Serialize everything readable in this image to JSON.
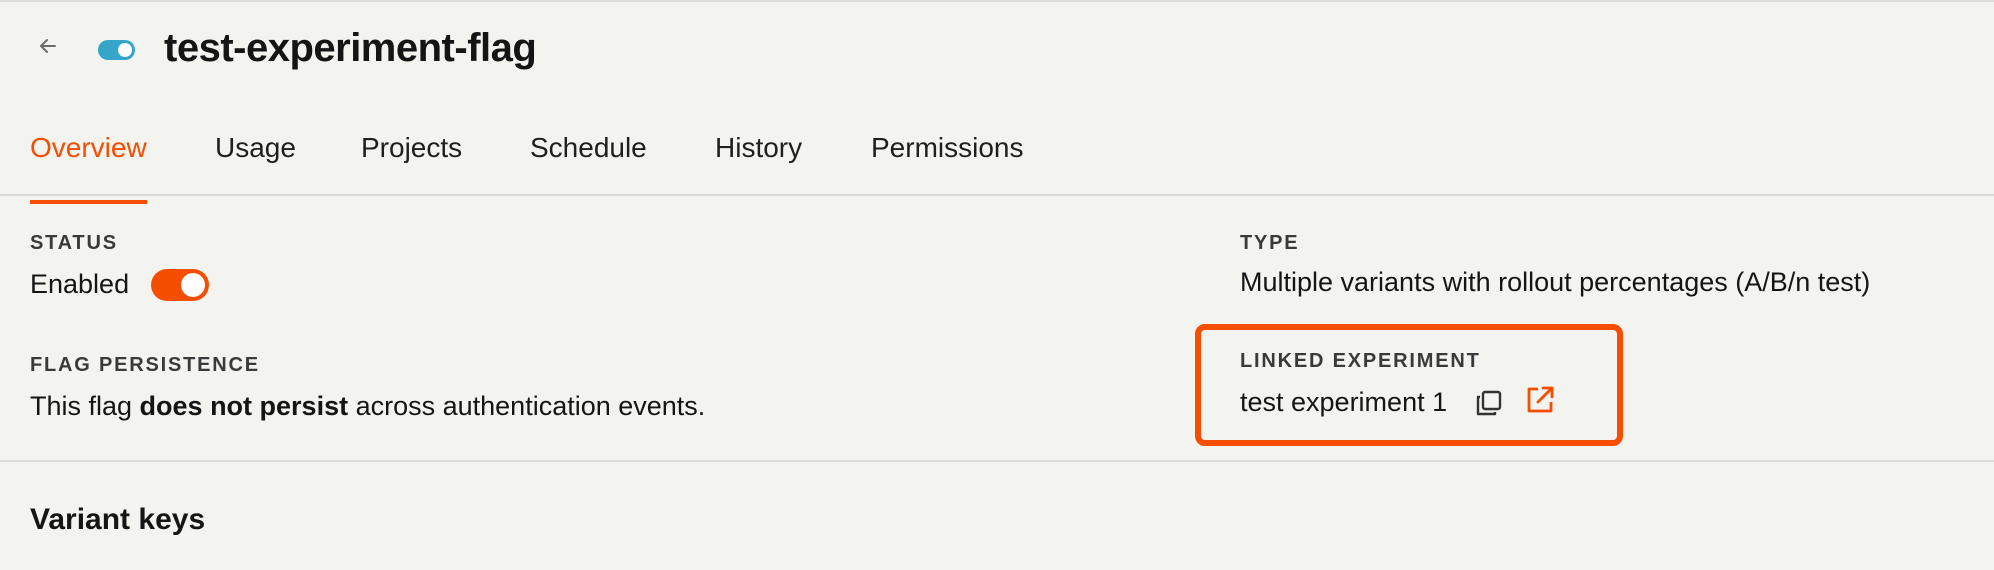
{
  "colors": {
    "accent": "#f54e00",
    "accent_teal": "#35a6c8"
  },
  "header": {
    "back_icon": "arrow-left-icon",
    "flag_icon": "toggle-icon",
    "title": "test-experiment-flag"
  },
  "tabs": [
    {
      "label": "Overview",
      "active": true
    },
    {
      "label": "Usage",
      "active": false
    },
    {
      "label": "Projects",
      "active": false
    },
    {
      "label": "Schedule",
      "active": false
    },
    {
      "label": "History",
      "active": false
    },
    {
      "label": "Permissions",
      "active": false
    }
  ],
  "status": {
    "label": "STATUS",
    "value": "Enabled",
    "enabled": true
  },
  "type": {
    "label": "TYPE",
    "value": "Multiple variants with rollout percentages (A/B/n test)"
  },
  "persistence": {
    "label": "FLAG PERSISTENCE",
    "prefix": "This flag ",
    "emphasis": "does not persist",
    "suffix": " across authentication events."
  },
  "linked_experiment": {
    "label": "LINKED EXPERIMENT",
    "value": "test experiment 1",
    "copy_icon": "copy-icon",
    "open_icon": "external-link-icon"
  },
  "variant_keys": {
    "title": "Variant keys"
  }
}
